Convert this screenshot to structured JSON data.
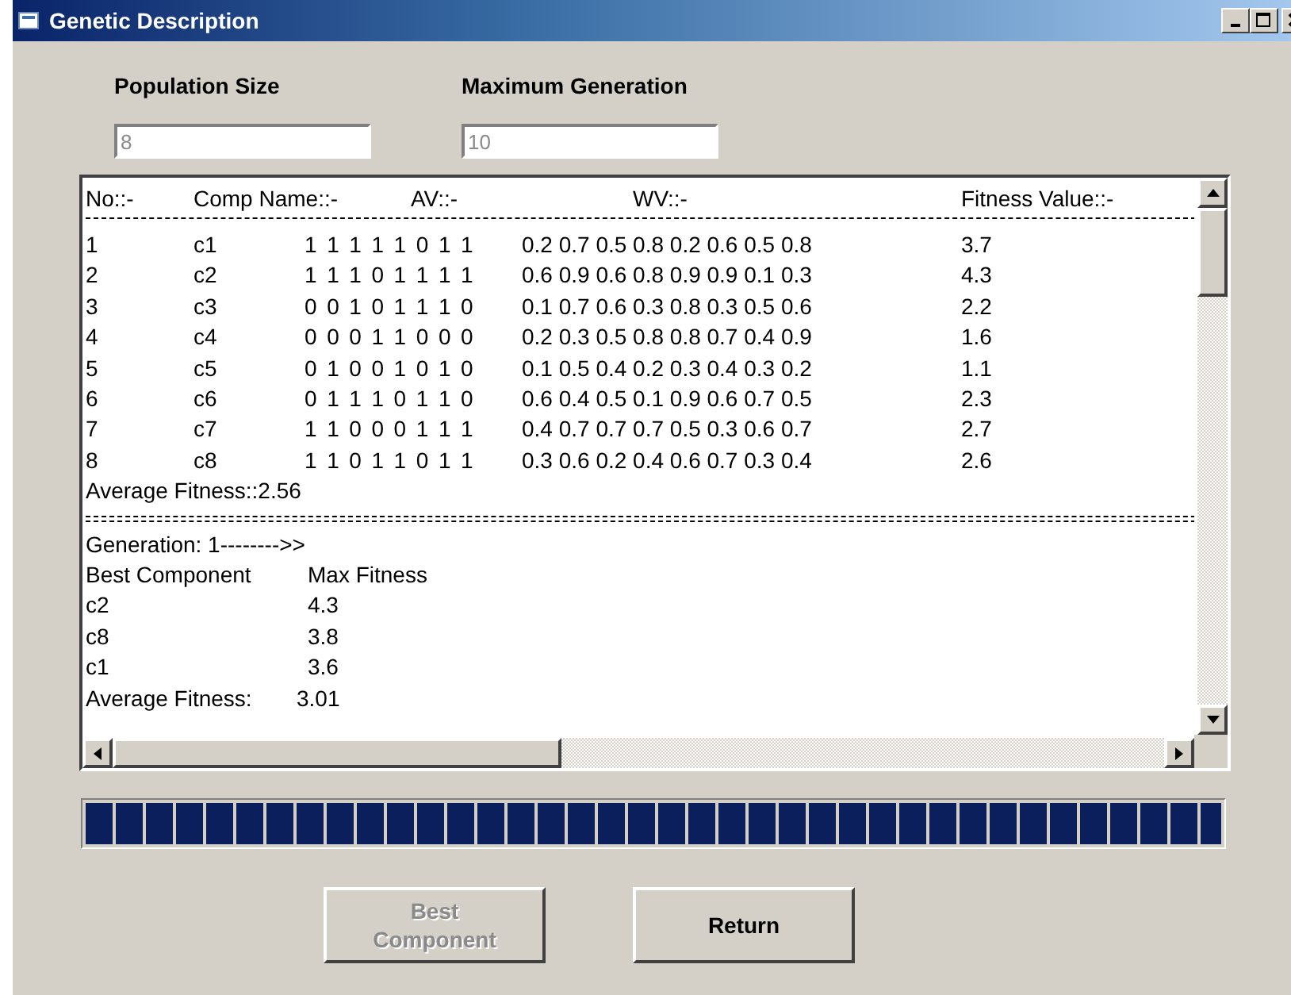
{
  "window": {
    "title": "Genetic Description"
  },
  "fields": [
    {
      "label": "Population Size",
      "value": "8",
      "disabled": true
    },
    {
      "label": "Maximum Generation",
      "value": "10",
      "disabled": true
    }
  ],
  "output": {
    "columns": [
      "No::-",
      "Comp Name::-",
      "AV::-",
      "WV::-",
      "Fitness Value::-"
    ],
    "rows": [
      {
        "no": "1",
        "name": "c1",
        "av": "1 1 1 1 1 0 1 1",
        "wv": "0.2 0.7 0.5 0.8 0.2 0.6 0.5 0.8",
        "fitness": "3.7"
      },
      {
        "no": "2",
        "name": "c2",
        "av": "1 1 1 0 1 1 1 1",
        "wv": "0.6 0.9 0.6 0.8 0.9 0.9 0.1 0.3",
        "fitness": "4.3"
      },
      {
        "no": "3",
        "name": "c3",
        "av": "0 0 1 0 1 1 1 0",
        "wv": "0.1 0.7 0.6 0.3 0.8 0.3 0.5 0.6",
        "fitness": "2.2"
      },
      {
        "no": "4",
        "name": "c4",
        "av": "0 0 0 1 1 0 0 0",
        "wv": "0.2 0.3 0.5 0.8 0.8 0.7 0.4 0.9",
        "fitness": "1.6"
      },
      {
        "no": "5",
        "name": "c5",
        "av": "0 1 0 0 1 0 1 0",
        "wv": "0.1 0.5 0.4 0.2 0.3 0.4 0.3 0.2",
        "fitness": "1.1"
      },
      {
        "no": "6",
        "name": "c6",
        "av": "0 1 1 1 0 1 1 0",
        "wv": "0.6 0.4 0.5 0.1 0.9 0.6 0.7 0.5",
        "fitness": "2.3"
      },
      {
        "no": "7",
        "name": "c7",
        "av": "1 1 0 0 0 1 1 1",
        "wv": "0.4 0.7 0.7 0.7 0.5 0.3 0.6 0.7",
        "fitness": "2.7"
      },
      {
        "no": "8",
        "name": "c8",
        "av": "1 1 0 1 1 0 1 1",
        "wv": "0.3 0.6 0.2 0.4 0.6 0.7 0.3 0.4",
        "fitness": "2.6"
      }
    ],
    "average": "Average Fitness::2.56",
    "generation": "Generation: 1-------->>",
    "best_columns": [
      "Best Component",
      "Max Fitness"
    ],
    "best_rows": [
      {
        "name": "c2",
        "fitness": "4.3"
      },
      {
        "name": "c8",
        "fitness": "3.8"
      },
      {
        "name": "c1",
        "fitness": "3.6"
      }
    ],
    "generation_average_label": "Average Fitness:",
    "generation_average_value": "3.01"
  },
  "progress": {
    "level": 1
  },
  "buttons": [
    {
      "label": "Best Component",
      "disabled": true
    },
    {
      "label": "Return",
      "disabled": false
    }
  ]
}
